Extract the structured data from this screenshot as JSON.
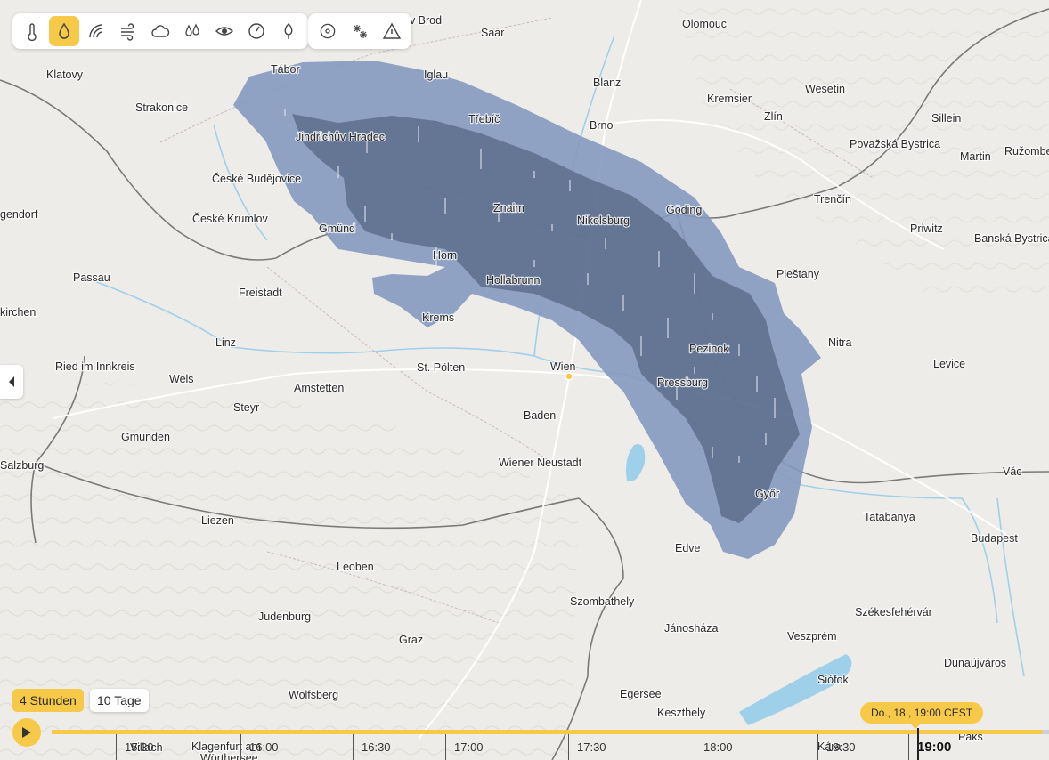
{
  "toolbar": {
    "primary": [
      {
        "icon": "thermometer-icon",
        "active": false
      },
      {
        "icon": "rain-drop-icon",
        "active": true
      },
      {
        "icon": "radar-icon",
        "active": false
      },
      {
        "icon": "wind-icon",
        "active": false
      },
      {
        "icon": "cloud-icon",
        "active": false
      },
      {
        "icon": "humidity-icon",
        "active": false
      },
      {
        "icon": "visibility-eye-icon",
        "active": false
      },
      {
        "icon": "pressure-gauge-icon",
        "active": false
      },
      {
        "icon": "pollen-tree-icon",
        "active": false
      }
    ],
    "secondary": [
      {
        "icon": "storm-icon",
        "active": false
      },
      {
        "icon": "snow-icon",
        "active": false
      },
      {
        "icon": "warning-icon",
        "active": false
      }
    ]
  },
  "colors": {
    "accent": "#f7c948",
    "precip_light": "#8397bd",
    "precip_heavy": "#5e6f8d",
    "border": "#7a7a7a"
  },
  "cities": [
    {
      "name": "Klatovy"
    },
    {
      "name": "Tábor"
    },
    {
      "name": "Iglau"
    },
    {
      "name": "Saar"
    },
    {
      "name": "vlíčkův Brod"
    },
    {
      "name": "Olomouc"
    },
    {
      "name": "Blanz"
    },
    {
      "name": "Kremsier"
    },
    {
      "name": "Wesetin"
    },
    {
      "name": "Strakonice"
    },
    {
      "name": "Třebíč"
    },
    {
      "name": "Brno"
    },
    {
      "name": "Zlín"
    },
    {
      "name": "Sillein"
    },
    {
      "name": "Jindřichův Hradec"
    },
    {
      "name": "Považská Bystrica"
    },
    {
      "name": "Martin"
    },
    {
      "name": "Ružomber"
    },
    {
      "name": "České Budějovice"
    },
    {
      "name": "Trenčín"
    },
    {
      "name": "gendorf"
    },
    {
      "name": "Znaim"
    },
    {
      "name": "Göding"
    },
    {
      "name": "České Krumlov"
    },
    {
      "name": "Nikolsburg"
    },
    {
      "name": "Gmünd"
    },
    {
      "name": "Priwitz"
    },
    {
      "name": "Banská Bystrica"
    },
    {
      "name": "Horn"
    },
    {
      "name": "Passau"
    },
    {
      "name": "Pieštany"
    },
    {
      "name": "Freistadt"
    },
    {
      "name": "Hollabrunn"
    },
    {
      "name": "kirchen"
    },
    {
      "name": "Krems"
    },
    {
      "name": "Linz"
    },
    {
      "name": "Nitra"
    },
    {
      "name": "Pezinok"
    },
    {
      "name": "Ried im Innkreis"
    },
    {
      "name": "St. Pölten"
    },
    {
      "name": "Wien"
    },
    {
      "name": "Levice"
    },
    {
      "name": "Wels"
    },
    {
      "name": "Amstetten"
    },
    {
      "name": "Pressburg"
    },
    {
      "name": "Steyr"
    },
    {
      "name": "Baden"
    },
    {
      "name": "Gmunden"
    },
    {
      "name": "Salzburg"
    },
    {
      "name": "Wiener Neustadt"
    },
    {
      "name": "Vác"
    },
    {
      "name": "Győr"
    },
    {
      "name": "Tatabanya"
    },
    {
      "name": "Liezen"
    },
    {
      "name": "Edve"
    },
    {
      "name": "Budapest"
    },
    {
      "name": "Leoben"
    },
    {
      "name": "Szombathely"
    },
    {
      "name": "Judenburg"
    },
    {
      "name": "Székesfehérvár"
    },
    {
      "name": "Jánosháza"
    },
    {
      "name": "Graz"
    },
    {
      "name": "Veszprém"
    },
    {
      "name": "Dunaújváros"
    },
    {
      "name": "Siófok"
    },
    {
      "name": "Wolfsberg"
    },
    {
      "name": "Egersee"
    },
    {
      "name": "Keszthely"
    },
    {
      "name": "Paks"
    }
  ],
  "timeline": {
    "range_4h": "4 Stunden",
    "range_10d": "10 Tage",
    "current": "Do., 18., 19:00 CEST",
    "ticks": [
      {
        "label": "15:30"
      },
      {
        "label": "16:00"
      },
      {
        "label": "16:30"
      },
      {
        "label": "17:00"
      },
      {
        "label": "17:30"
      },
      {
        "label": "18:00"
      },
      {
        "label": "18:30"
      },
      {
        "label": "19:00",
        "bold": true
      }
    ],
    "underlay_labels": [
      "Villach",
      "Klagenfurt am",
      "Wörthersee",
      "Kára"
    ]
  }
}
